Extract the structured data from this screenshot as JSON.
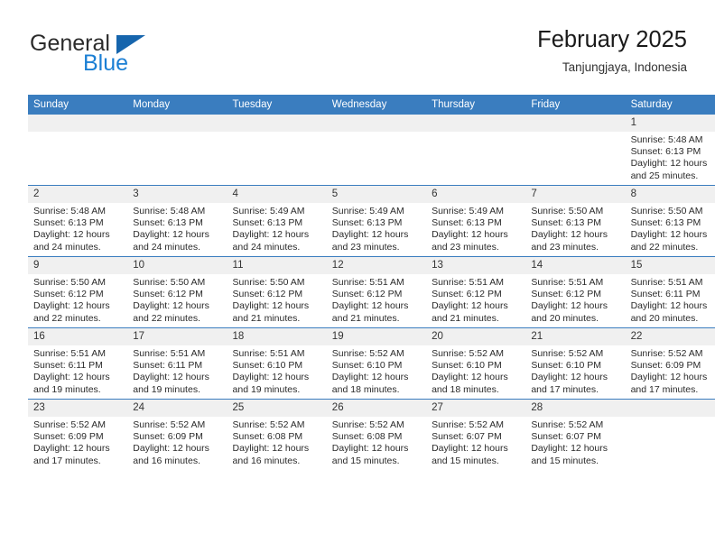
{
  "brand": {
    "word1": "General",
    "word2": "Blue",
    "triangle_color": "#1665ad",
    "blue_color": "#1b7fd4"
  },
  "header": {
    "title": "February 2025",
    "location": "Tanjungjaya, Indonesia"
  },
  "theme": {
    "header_bg": "#3a7dbf",
    "header_text": "#ffffff",
    "daynum_bg": "#f0f0f0",
    "row_divider": "#3a7dbf"
  },
  "weekdays": [
    "Sunday",
    "Monday",
    "Tuesday",
    "Wednesday",
    "Thursday",
    "Friday",
    "Saturday"
  ],
  "weeks": [
    [
      {
        "day": "",
        "sunrise": "",
        "sunset": "",
        "daylight1": "",
        "daylight2": "",
        "empty": true
      },
      {
        "day": "",
        "sunrise": "",
        "sunset": "",
        "daylight1": "",
        "daylight2": "",
        "empty": true
      },
      {
        "day": "",
        "sunrise": "",
        "sunset": "",
        "daylight1": "",
        "daylight2": "",
        "empty": true
      },
      {
        "day": "",
        "sunrise": "",
        "sunset": "",
        "daylight1": "",
        "daylight2": "",
        "empty": true
      },
      {
        "day": "",
        "sunrise": "",
        "sunset": "",
        "daylight1": "",
        "daylight2": "",
        "empty": true
      },
      {
        "day": "",
        "sunrise": "",
        "sunset": "",
        "daylight1": "",
        "daylight2": "",
        "empty": true
      },
      {
        "day": "1",
        "sunrise": "Sunrise: 5:48 AM",
        "sunset": "Sunset: 6:13 PM",
        "daylight1": "Daylight: 12 hours",
        "daylight2": "and 25 minutes.",
        "empty": false
      }
    ],
    [
      {
        "day": "2",
        "sunrise": "Sunrise: 5:48 AM",
        "sunset": "Sunset: 6:13 PM",
        "daylight1": "Daylight: 12 hours",
        "daylight2": "and 24 minutes.",
        "empty": false
      },
      {
        "day": "3",
        "sunrise": "Sunrise: 5:48 AM",
        "sunset": "Sunset: 6:13 PM",
        "daylight1": "Daylight: 12 hours",
        "daylight2": "and 24 minutes.",
        "empty": false
      },
      {
        "day": "4",
        "sunrise": "Sunrise: 5:49 AM",
        "sunset": "Sunset: 6:13 PM",
        "daylight1": "Daylight: 12 hours",
        "daylight2": "and 24 minutes.",
        "empty": false
      },
      {
        "day": "5",
        "sunrise": "Sunrise: 5:49 AM",
        "sunset": "Sunset: 6:13 PM",
        "daylight1": "Daylight: 12 hours",
        "daylight2": "and 23 minutes.",
        "empty": false
      },
      {
        "day": "6",
        "sunrise": "Sunrise: 5:49 AM",
        "sunset": "Sunset: 6:13 PM",
        "daylight1": "Daylight: 12 hours",
        "daylight2": "and 23 minutes.",
        "empty": false
      },
      {
        "day": "7",
        "sunrise": "Sunrise: 5:50 AM",
        "sunset": "Sunset: 6:13 PM",
        "daylight1": "Daylight: 12 hours",
        "daylight2": "and 23 minutes.",
        "empty": false
      },
      {
        "day": "8",
        "sunrise": "Sunrise: 5:50 AM",
        "sunset": "Sunset: 6:13 PM",
        "daylight1": "Daylight: 12 hours",
        "daylight2": "and 22 minutes.",
        "empty": false
      }
    ],
    [
      {
        "day": "9",
        "sunrise": "Sunrise: 5:50 AM",
        "sunset": "Sunset: 6:12 PM",
        "daylight1": "Daylight: 12 hours",
        "daylight2": "and 22 minutes.",
        "empty": false
      },
      {
        "day": "10",
        "sunrise": "Sunrise: 5:50 AM",
        "sunset": "Sunset: 6:12 PM",
        "daylight1": "Daylight: 12 hours",
        "daylight2": "and 22 minutes.",
        "empty": false
      },
      {
        "day": "11",
        "sunrise": "Sunrise: 5:50 AM",
        "sunset": "Sunset: 6:12 PM",
        "daylight1": "Daylight: 12 hours",
        "daylight2": "and 21 minutes.",
        "empty": false
      },
      {
        "day": "12",
        "sunrise": "Sunrise: 5:51 AM",
        "sunset": "Sunset: 6:12 PM",
        "daylight1": "Daylight: 12 hours",
        "daylight2": "and 21 minutes.",
        "empty": false
      },
      {
        "day": "13",
        "sunrise": "Sunrise: 5:51 AM",
        "sunset": "Sunset: 6:12 PM",
        "daylight1": "Daylight: 12 hours",
        "daylight2": "and 21 minutes.",
        "empty": false
      },
      {
        "day": "14",
        "sunrise": "Sunrise: 5:51 AM",
        "sunset": "Sunset: 6:12 PM",
        "daylight1": "Daylight: 12 hours",
        "daylight2": "and 20 minutes.",
        "empty": false
      },
      {
        "day": "15",
        "sunrise": "Sunrise: 5:51 AM",
        "sunset": "Sunset: 6:11 PM",
        "daylight1": "Daylight: 12 hours",
        "daylight2": "and 20 minutes.",
        "empty": false
      }
    ],
    [
      {
        "day": "16",
        "sunrise": "Sunrise: 5:51 AM",
        "sunset": "Sunset: 6:11 PM",
        "daylight1": "Daylight: 12 hours",
        "daylight2": "and 19 minutes.",
        "empty": false
      },
      {
        "day": "17",
        "sunrise": "Sunrise: 5:51 AM",
        "sunset": "Sunset: 6:11 PM",
        "daylight1": "Daylight: 12 hours",
        "daylight2": "and 19 minutes.",
        "empty": false
      },
      {
        "day": "18",
        "sunrise": "Sunrise: 5:51 AM",
        "sunset": "Sunset: 6:10 PM",
        "daylight1": "Daylight: 12 hours",
        "daylight2": "and 19 minutes.",
        "empty": false
      },
      {
        "day": "19",
        "sunrise": "Sunrise: 5:52 AM",
        "sunset": "Sunset: 6:10 PM",
        "daylight1": "Daylight: 12 hours",
        "daylight2": "and 18 minutes.",
        "empty": false
      },
      {
        "day": "20",
        "sunrise": "Sunrise: 5:52 AM",
        "sunset": "Sunset: 6:10 PM",
        "daylight1": "Daylight: 12 hours",
        "daylight2": "and 18 minutes.",
        "empty": false
      },
      {
        "day": "21",
        "sunrise": "Sunrise: 5:52 AM",
        "sunset": "Sunset: 6:10 PM",
        "daylight1": "Daylight: 12 hours",
        "daylight2": "and 17 minutes.",
        "empty": false
      },
      {
        "day": "22",
        "sunrise": "Sunrise: 5:52 AM",
        "sunset": "Sunset: 6:09 PM",
        "daylight1": "Daylight: 12 hours",
        "daylight2": "and 17 minutes.",
        "empty": false
      }
    ],
    [
      {
        "day": "23",
        "sunrise": "Sunrise: 5:52 AM",
        "sunset": "Sunset: 6:09 PM",
        "daylight1": "Daylight: 12 hours",
        "daylight2": "and 17 minutes.",
        "empty": false
      },
      {
        "day": "24",
        "sunrise": "Sunrise: 5:52 AM",
        "sunset": "Sunset: 6:09 PM",
        "daylight1": "Daylight: 12 hours",
        "daylight2": "and 16 minutes.",
        "empty": false
      },
      {
        "day": "25",
        "sunrise": "Sunrise: 5:52 AM",
        "sunset": "Sunset: 6:08 PM",
        "daylight1": "Daylight: 12 hours",
        "daylight2": "and 16 minutes.",
        "empty": false
      },
      {
        "day": "26",
        "sunrise": "Sunrise: 5:52 AM",
        "sunset": "Sunset: 6:08 PM",
        "daylight1": "Daylight: 12 hours",
        "daylight2": "and 15 minutes.",
        "empty": false
      },
      {
        "day": "27",
        "sunrise": "Sunrise: 5:52 AM",
        "sunset": "Sunset: 6:07 PM",
        "daylight1": "Daylight: 12 hours",
        "daylight2": "and 15 minutes.",
        "empty": false
      },
      {
        "day": "28",
        "sunrise": "Sunrise: 5:52 AM",
        "sunset": "Sunset: 6:07 PM",
        "daylight1": "Daylight: 12 hours",
        "daylight2": "and 15 minutes.",
        "empty": false
      },
      {
        "day": "",
        "sunrise": "",
        "sunset": "",
        "daylight1": "",
        "daylight2": "",
        "empty": true
      }
    ]
  ]
}
